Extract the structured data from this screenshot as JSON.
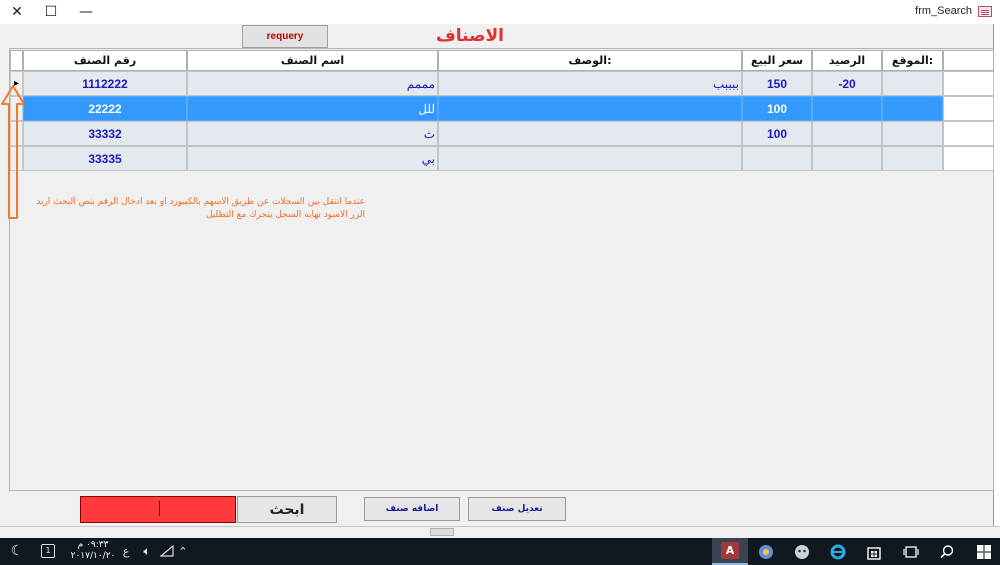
{
  "window": {
    "title": "frm_Search",
    "close_glyph": "✕",
    "maximize_glyph": "☐",
    "minimize_glyph": "—"
  },
  "form": {
    "title": "الاصناف",
    "requery_label": "requery"
  },
  "grid": {
    "columns": [
      "رقم الصنف",
      "اسم الصنف",
      "الوصف:",
      "سعر البيع",
      "الرصيد",
      "الموقع:"
    ],
    "record_indicator": "▸",
    "rows": [
      {
        "code": "1112222",
        "name": "مممم",
        "desc": "ببببب",
        "price": "150",
        "balance": "-20",
        "location": ""
      },
      {
        "code": "22222",
        "name": "للل",
        "desc": "",
        "price": "100",
        "balance": "",
        "location": ""
      },
      {
        "code": "33332",
        "name": "ث",
        "desc": "",
        "price": "100",
        "balance": "",
        "location": ""
      },
      {
        "code": "33335",
        "name": "بي",
        "desc": "",
        "price": "",
        "balance": "",
        "location": ""
      }
    ],
    "selected_row": 1
  },
  "note": {
    "line1": "عندما انتقل بين السجلات عن طريق الاسهم بالكيبورد او بعد ادخال الرقم بنص البحث اريد",
    "line2": "الزر الاسود نهايه السجل يتحرك مع التظليل"
  },
  "footer": {
    "search_value": "",
    "search_button": "ابحث",
    "add_button": "اضافه صنف",
    "edit_button": "تعديل صنف"
  },
  "taskbar": {
    "clock_time": "٠٩:٣٣ م",
    "clock_date": "٢٠١٧/١٠/٢٠",
    "lang": "ع",
    "notification_count": "1"
  },
  "colors": {
    "title_red": "#e03030",
    "selection": "#3399ff",
    "cell_text": "#1a1ab8",
    "note_orange": "#e8702a",
    "search_red": "#ff3a3a"
  }
}
